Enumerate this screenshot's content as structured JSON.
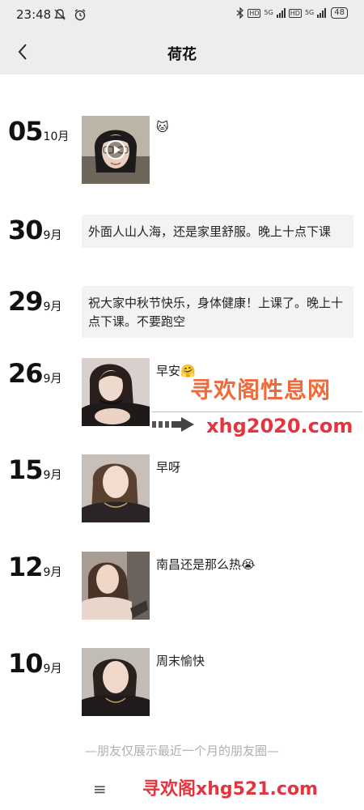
{
  "status_bar": {
    "time": "23:48",
    "left_icons": [
      "muted-bell-icon",
      "alarm-icon"
    ],
    "net1": "HD",
    "net1_gen": "5G",
    "net2": "HD",
    "net2_gen": "5G",
    "battery": "48"
  },
  "header": {
    "title": "荷花"
  },
  "posts": [
    {
      "day": "05",
      "month": "10月",
      "kind": "video",
      "caption": "🐱"
    },
    {
      "day": "30",
      "month": "9月",
      "kind": "text",
      "text": "外面人山人海，还是家里舒服。晚上十点下课"
    },
    {
      "day": "29",
      "month": "9月",
      "kind": "text",
      "text": "祝大家中秋节快乐，身体健康！上课了。晚上十点下课。不要跑空"
    },
    {
      "day": "26",
      "month": "9月",
      "kind": "photo",
      "caption": "早安🤗"
    },
    {
      "day": "15",
      "month": "9月",
      "kind": "photo",
      "caption": "早呀"
    },
    {
      "day": "12",
      "month": "9月",
      "kind": "photo",
      "caption": "南昌还是那么热😭"
    },
    {
      "day": "10",
      "month": "9月",
      "kind": "photo",
      "caption": "周末愉快"
    }
  ],
  "watermark": {
    "title": "寻欢阁性息网",
    "url": "xhg2020.com",
    "bottom": "寻欢阁xhg521.com"
  },
  "footer": {
    "note": "—朋友仅展示最近一个月的朋友圈—",
    "menu_glyph": "≡"
  },
  "colors": {
    "header_bg": "#ededed",
    "text_post_bg": "#f3f3f3",
    "watermark_orange": "#f06a3a",
    "watermark_red": "#e4343d"
  }
}
